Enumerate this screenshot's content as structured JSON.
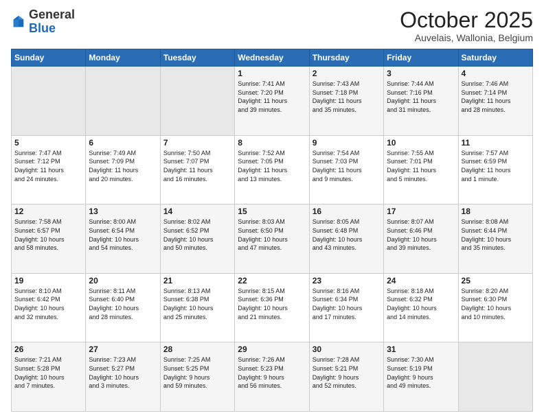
{
  "logo": {
    "general": "General",
    "blue": "Blue"
  },
  "header": {
    "month": "October 2025",
    "location": "Auvelais, Wallonia, Belgium"
  },
  "weekdays": [
    "Sunday",
    "Monday",
    "Tuesday",
    "Wednesday",
    "Thursday",
    "Friday",
    "Saturday"
  ],
  "weeks": [
    [
      {
        "day": "",
        "info": ""
      },
      {
        "day": "",
        "info": ""
      },
      {
        "day": "",
        "info": ""
      },
      {
        "day": "1",
        "info": "Sunrise: 7:41 AM\nSunset: 7:20 PM\nDaylight: 11 hours\nand 39 minutes."
      },
      {
        "day": "2",
        "info": "Sunrise: 7:43 AM\nSunset: 7:18 PM\nDaylight: 11 hours\nand 35 minutes."
      },
      {
        "day": "3",
        "info": "Sunrise: 7:44 AM\nSunset: 7:16 PM\nDaylight: 11 hours\nand 31 minutes."
      },
      {
        "day": "4",
        "info": "Sunrise: 7:46 AM\nSunset: 7:14 PM\nDaylight: 11 hours\nand 28 minutes."
      }
    ],
    [
      {
        "day": "5",
        "info": "Sunrise: 7:47 AM\nSunset: 7:12 PM\nDaylight: 11 hours\nand 24 minutes."
      },
      {
        "day": "6",
        "info": "Sunrise: 7:49 AM\nSunset: 7:09 PM\nDaylight: 11 hours\nand 20 minutes."
      },
      {
        "day": "7",
        "info": "Sunrise: 7:50 AM\nSunset: 7:07 PM\nDaylight: 11 hours\nand 16 minutes."
      },
      {
        "day": "8",
        "info": "Sunrise: 7:52 AM\nSunset: 7:05 PM\nDaylight: 11 hours\nand 13 minutes."
      },
      {
        "day": "9",
        "info": "Sunrise: 7:54 AM\nSunset: 7:03 PM\nDaylight: 11 hours\nand 9 minutes."
      },
      {
        "day": "10",
        "info": "Sunrise: 7:55 AM\nSunset: 7:01 PM\nDaylight: 11 hours\nand 5 minutes."
      },
      {
        "day": "11",
        "info": "Sunrise: 7:57 AM\nSunset: 6:59 PM\nDaylight: 11 hours\nand 1 minute."
      }
    ],
    [
      {
        "day": "12",
        "info": "Sunrise: 7:58 AM\nSunset: 6:57 PM\nDaylight: 10 hours\nand 58 minutes."
      },
      {
        "day": "13",
        "info": "Sunrise: 8:00 AM\nSunset: 6:54 PM\nDaylight: 10 hours\nand 54 minutes."
      },
      {
        "day": "14",
        "info": "Sunrise: 8:02 AM\nSunset: 6:52 PM\nDaylight: 10 hours\nand 50 minutes."
      },
      {
        "day": "15",
        "info": "Sunrise: 8:03 AM\nSunset: 6:50 PM\nDaylight: 10 hours\nand 47 minutes."
      },
      {
        "day": "16",
        "info": "Sunrise: 8:05 AM\nSunset: 6:48 PM\nDaylight: 10 hours\nand 43 minutes."
      },
      {
        "day": "17",
        "info": "Sunrise: 8:07 AM\nSunset: 6:46 PM\nDaylight: 10 hours\nand 39 minutes."
      },
      {
        "day": "18",
        "info": "Sunrise: 8:08 AM\nSunset: 6:44 PM\nDaylight: 10 hours\nand 35 minutes."
      }
    ],
    [
      {
        "day": "19",
        "info": "Sunrise: 8:10 AM\nSunset: 6:42 PM\nDaylight: 10 hours\nand 32 minutes."
      },
      {
        "day": "20",
        "info": "Sunrise: 8:11 AM\nSunset: 6:40 PM\nDaylight: 10 hours\nand 28 minutes."
      },
      {
        "day": "21",
        "info": "Sunrise: 8:13 AM\nSunset: 6:38 PM\nDaylight: 10 hours\nand 25 minutes."
      },
      {
        "day": "22",
        "info": "Sunrise: 8:15 AM\nSunset: 6:36 PM\nDaylight: 10 hours\nand 21 minutes."
      },
      {
        "day": "23",
        "info": "Sunrise: 8:16 AM\nSunset: 6:34 PM\nDaylight: 10 hours\nand 17 minutes."
      },
      {
        "day": "24",
        "info": "Sunrise: 8:18 AM\nSunset: 6:32 PM\nDaylight: 10 hours\nand 14 minutes."
      },
      {
        "day": "25",
        "info": "Sunrise: 8:20 AM\nSunset: 6:30 PM\nDaylight: 10 hours\nand 10 minutes."
      }
    ],
    [
      {
        "day": "26",
        "info": "Sunrise: 7:21 AM\nSunset: 5:28 PM\nDaylight: 10 hours\nand 7 minutes."
      },
      {
        "day": "27",
        "info": "Sunrise: 7:23 AM\nSunset: 5:27 PM\nDaylight: 10 hours\nand 3 minutes."
      },
      {
        "day": "28",
        "info": "Sunrise: 7:25 AM\nSunset: 5:25 PM\nDaylight: 9 hours\nand 59 minutes."
      },
      {
        "day": "29",
        "info": "Sunrise: 7:26 AM\nSunset: 5:23 PM\nDaylight: 9 hours\nand 56 minutes."
      },
      {
        "day": "30",
        "info": "Sunrise: 7:28 AM\nSunset: 5:21 PM\nDaylight: 9 hours\nand 52 minutes."
      },
      {
        "day": "31",
        "info": "Sunrise: 7:30 AM\nSunset: 5:19 PM\nDaylight: 9 hours\nand 49 minutes."
      },
      {
        "day": "",
        "info": ""
      }
    ]
  ]
}
